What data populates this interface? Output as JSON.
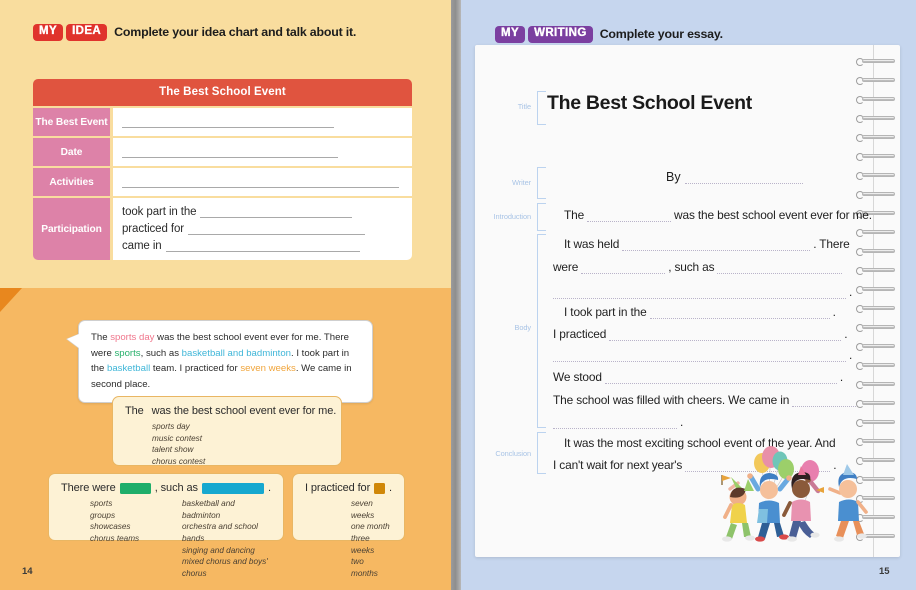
{
  "left_page": {
    "number": "14",
    "section": {
      "badge_words": [
        "MY",
        "IDEA"
      ],
      "instruction": "Complete your idea chart and talk about it."
    },
    "idea_chart": {
      "title": "The Best School Event",
      "rows": [
        {
          "label": "The Best Event",
          "value": ""
        },
        {
          "label": "Date",
          "value": ""
        },
        {
          "label": "Activities",
          "value": ""
        }
      ],
      "participation": {
        "label": "Participation",
        "lines": [
          "took part in the",
          "practiced for",
          "came in"
        ]
      }
    },
    "example_bubble": {
      "t1": "The ",
      "h1": "sports day",
      "t2": " was the best school event ever for me. There were ",
      "h2": "sports",
      "t3": ", such as ",
      "h3": "basketball and badminton",
      "t4": ". I took part in the ",
      "h4": "basketball",
      "t5": " team. I practiced for ",
      "h5": "seven weeks",
      "t6": ". We came in second place."
    },
    "frames": [
      {
        "pre": "The",
        "post": "was the best school event ever for me.",
        "chip_color": "#f0899a",
        "options": [
          "sports day",
          "music contest",
          "talent show",
          "chorus contest"
        ]
      },
      {
        "pre": "There were",
        "mid": ", such as",
        "post": ".",
        "chip_color_a": "#1fae6a",
        "chip_color_b": "#17a8cf",
        "options_a": [
          "sports",
          "groups",
          "showcases",
          "chorus teams"
        ],
        "options_b": [
          "basketball and badminton",
          "orchestra and school bands",
          "singing and dancing",
          "mixed chorus and boys' chorus"
        ]
      },
      {
        "pre": "I practiced for",
        "post": ".",
        "chip_color": "#d08708",
        "options": [
          "seven weeks",
          "one month",
          "three weeks",
          "two months"
        ]
      }
    ]
  },
  "right_page": {
    "number": "15",
    "section": {
      "badge_words": [
        "MY",
        "WRITING"
      ],
      "instruction": "Complete your essay."
    },
    "essay": {
      "title": "The Best School Event",
      "by_label": "By",
      "section_labels": {
        "title": "Title",
        "writer": "Writer",
        "introduction": "Introduction",
        "body": "Body",
        "conclusion": "Conclusion"
      },
      "lines": {
        "intro_a": "The",
        "intro_b": "was the best school event ever for me.",
        "body_1a": "It was held",
        "body_1b": ". There",
        "body_2a": "were",
        "body_2b": ", such as",
        "body_3": ".",
        "body_4a": "I took part in the",
        "body_4b": ".",
        "body_5a": "I practiced",
        "body_5b": ".",
        "body_6": ".",
        "body_7a": "We stood",
        "body_7b": ".",
        "body_8": "The school was filled with cheers. We came in",
        "body_9": ".",
        "concl_1": "It was the most exciting school event of the year. And",
        "concl_2a": "I can't wait for next year's",
        "concl_2b": "."
      }
    },
    "illustration": "children-celebrating-with-balloons"
  }
}
